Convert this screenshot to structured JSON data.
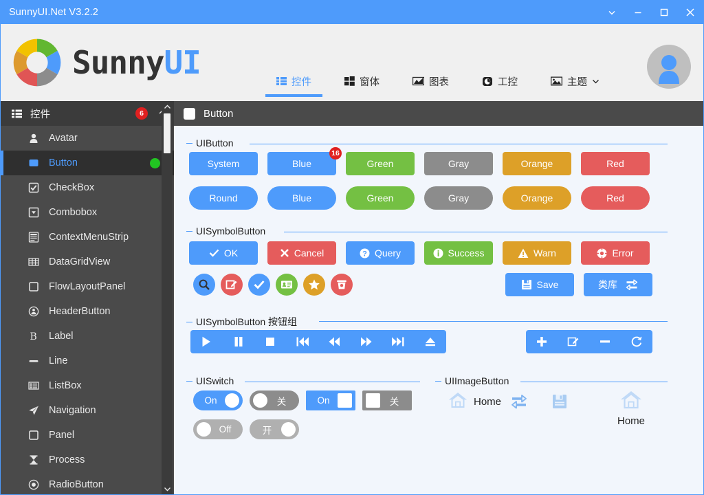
{
  "window": {
    "title": "SunnyUI.Net V3.2.2",
    "title_bg": "#4e9bfb",
    "buttons": [
      {
        "name": "chevron-down-icon",
        "label": "⌄"
      },
      {
        "name": "minimize-icon",
        "label": "—"
      },
      {
        "name": "maximize-icon",
        "label": "□"
      },
      {
        "name": "close-icon",
        "label": "✕"
      }
    ]
  },
  "header": {
    "logo_text_1": "Sunny",
    "logo_text_2": "UI",
    "logo_colors": [
      "#f2c200",
      "#62b731",
      "#4e9bfb",
      "#8c8c8c",
      "#e05555",
      "#dd9a2e"
    ],
    "nav": [
      {
        "label": "控件",
        "icon": "list-icon",
        "active": true
      },
      {
        "label": "窗体",
        "icon": "windows-icon",
        "active": false
      },
      {
        "label": "图表",
        "icon": "chart-icon",
        "active": false
      },
      {
        "label": "工控",
        "icon": "gauge-icon",
        "active": false
      },
      {
        "label": "主题",
        "icon": "image-icon",
        "active": false,
        "caret": true
      }
    ]
  },
  "sidebar": {
    "header_label": "控件",
    "header_badge": "6",
    "items": [
      {
        "label": "Avatar",
        "icon": "avatar-icon",
        "selected": false
      },
      {
        "label": "Button",
        "icon": "button-icon",
        "selected": true,
        "dot": "#22c522"
      },
      {
        "label": "CheckBox",
        "icon": "checkbox-icon",
        "selected": false
      },
      {
        "label": "Combobox",
        "icon": "combobox-icon",
        "selected": false
      },
      {
        "label": "ContextMenuStrip",
        "icon": "contextmenu-icon",
        "selected": false
      },
      {
        "label": "DataGridView",
        "icon": "grid-icon",
        "selected": false
      },
      {
        "label": "FlowLayoutPanel",
        "icon": "panel-icon",
        "selected": false
      },
      {
        "label": "HeaderButton",
        "icon": "headerbutton-icon",
        "selected": false
      },
      {
        "label": "Label",
        "icon": "label-icon",
        "selected": false
      },
      {
        "label": "Line",
        "icon": "line-icon",
        "selected": false
      },
      {
        "label": "ListBox",
        "icon": "listbox-icon",
        "selected": false
      },
      {
        "label": "Navigation",
        "icon": "navigation-icon",
        "selected": false
      },
      {
        "label": "Panel",
        "icon": "panel-icon",
        "selected": false
      },
      {
        "label": "Process",
        "icon": "hourglass-icon",
        "selected": false
      },
      {
        "label": "RadioButton",
        "icon": "radio-icon",
        "selected": false
      }
    ]
  },
  "content": {
    "title": "Button",
    "groups": {
      "uibutton": "UIButton",
      "uisymbolbutton": "UISymbolButton",
      "uisymbolbutton_group": "UISymbolButton 按钮组",
      "uiswitch": "UISwitch",
      "uiimagebutton": "UIImageButton"
    },
    "uibutton_row1": [
      {
        "label": "System",
        "color": "#4e9bfb"
      },
      {
        "label": "Blue",
        "color": "#4e9bfb",
        "badge": "16"
      },
      {
        "label": "Green",
        "color": "#74c043"
      },
      {
        "label": "Gray",
        "color": "#8c8c8c"
      },
      {
        "label": "Orange",
        "color": "#dda028"
      },
      {
        "label": "Red",
        "color": "#e55c5c"
      }
    ],
    "uibutton_row2": [
      {
        "label": "Round",
        "color": "#4e9bfb"
      },
      {
        "label": "Blue",
        "color": "#4e9bfb"
      },
      {
        "label": "Green",
        "color": "#74c043"
      },
      {
        "label": "Gray",
        "color": "#8c8c8c"
      },
      {
        "label": "Orange",
        "color": "#dda028"
      },
      {
        "label": "Red",
        "color": "#e55c5c"
      }
    ],
    "symbol_row1": [
      {
        "label": "OK",
        "color": "#4e9bfb",
        "icon": "check-icon"
      },
      {
        "label": "Cancel",
        "color": "#e55c5c",
        "icon": "cross-icon"
      },
      {
        "label": "Query",
        "color": "#4e9bfb",
        "icon": "question-circle-icon"
      },
      {
        "label": "Success",
        "color": "#74c043",
        "icon": "info-circle-icon"
      },
      {
        "label": "Warn",
        "color": "#dda028",
        "icon": "warning-triangle-icon"
      },
      {
        "label": "Error",
        "color": "#e55c5c",
        "icon": "error-circle-icon"
      }
    ],
    "symbol_circles": [
      {
        "icon": "search-icon",
        "color": "#4e9bfb"
      },
      {
        "icon": "edit-icon",
        "color": "#e55c5c"
      },
      {
        "icon": "check-icon",
        "color": "#4e9bfb"
      },
      {
        "icon": "id-card-icon",
        "color": "#74c043"
      },
      {
        "icon": "star-icon",
        "color": "#dda028"
      },
      {
        "icon": "trash-icon",
        "color": "#e55c5c"
      }
    ],
    "symbol_right": [
      {
        "label": "Save",
        "color": "#4e9bfb",
        "icon": "floppy-disk-icon",
        "icon_pos": "left"
      },
      {
        "label": "类库",
        "color": "#4e9bfb",
        "icon": "swap-icon",
        "icon_pos": "right"
      }
    ],
    "media_group": [
      "play-icon",
      "pause-icon",
      "stop-icon",
      "prev-track-icon",
      "rewind-icon",
      "fast-forward-icon",
      "next-track-icon",
      "eject-icon"
    ],
    "edit_group": [
      "plus-icon",
      "edit-icon",
      "minus-icon",
      "refresh-icon"
    ],
    "switches": [
      {
        "label": "On",
        "color": "#4e9bfb",
        "shape": "round",
        "on": true
      },
      {
        "label": "关",
        "color": "#8c8c8c",
        "shape": "round",
        "on": false
      },
      {
        "label": "On",
        "color": "#4e9bfb",
        "shape": "square",
        "on": true
      },
      {
        "label": "关",
        "color": "#8c8c8c",
        "shape": "square",
        "on": false
      },
      {
        "label": "Off",
        "color": "#b0b0b0",
        "shape": "round",
        "on": false
      },
      {
        "label": "开",
        "color": "#b0b0b0",
        "shape": "round",
        "on": true
      }
    ],
    "image_buttons": [
      {
        "label": "Home",
        "icon": "home-icon",
        "layout": "horizontal"
      },
      {
        "label": "",
        "icon": "swap-icon",
        "layout": "icon-only"
      },
      {
        "label": "",
        "icon": "floppy-disk-icon",
        "layout": "icon-only"
      },
      {
        "label": "Home",
        "icon": "home-icon",
        "layout": "vertical"
      }
    ]
  }
}
